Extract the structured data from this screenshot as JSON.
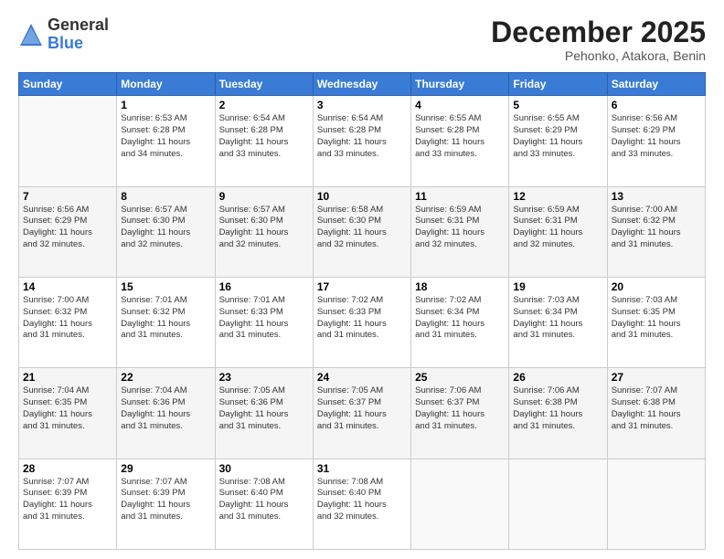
{
  "logo": {
    "general": "General",
    "blue": "Blue"
  },
  "title": "December 2025",
  "location": "Pehonko, Atakora, Benin",
  "days_of_week": [
    "Sunday",
    "Monday",
    "Tuesday",
    "Wednesday",
    "Thursday",
    "Friday",
    "Saturday"
  ],
  "weeks": [
    [
      {
        "day": "",
        "info": ""
      },
      {
        "day": "1",
        "info": "Sunrise: 6:53 AM\nSunset: 6:28 PM\nDaylight: 11 hours\nand 34 minutes."
      },
      {
        "day": "2",
        "info": "Sunrise: 6:54 AM\nSunset: 6:28 PM\nDaylight: 11 hours\nand 33 minutes."
      },
      {
        "day": "3",
        "info": "Sunrise: 6:54 AM\nSunset: 6:28 PM\nDaylight: 11 hours\nand 33 minutes."
      },
      {
        "day": "4",
        "info": "Sunrise: 6:55 AM\nSunset: 6:28 PM\nDaylight: 11 hours\nand 33 minutes."
      },
      {
        "day": "5",
        "info": "Sunrise: 6:55 AM\nSunset: 6:29 PM\nDaylight: 11 hours\nand 33 minutes."
      },
      {
        "day": "6",
        "info": "Sunrise: 6:56 AM\nSunset: 6:29 PM\nDaylight: 11 hours\nand 33 minutes."
      }
    ],
    [
      {
        "day": "7",
        "info": "Sunrise: 6:56 AM\nSunset: 6:29 PM\nDaylight: 11 hours\nand 32 minutes."
      },
      {
        "day": "8",
        "info": "Sunrise: 6:57 AM\nSunset: 6:30 PM\nDaylight: 11 hours\nand 32 minutes."
      },
      {
        "day": "9",
        "info": "Sunrise: 6:57 AM\nSunset: 6:30 PM\nDaylight: 11 hours\nand 32 minutes."
      },
      {
        "day": "10",
        "info": "Sunrise: 6:58 AM\nSunset: 6:30 PM\nDaylight: 11 hours\nand 32 minutes."
      },
      {
        "day": "11",
        "info": "Sunrise: 6:59 AM\nSunset: 6:31 PM\nDaylight: 11 hours\nand 32 minutes."
      },
      {
        "day": "12",
        "info": "Sunrise: 6:59 AM\nSunset: 6:31 PM\nDaylight: 11 hours\nand 32 minutes."
      },
      {
        "day": "13",
        "info": "Sunrise: 7:00 AM\nSunset: 6:32 PM\nDaylight: 11 hours\nand 31 minutes."
      }
    ],
    [
      {
        "day": "14",
        "info": "Sunrise: 7:00 AM\nSunset: 6:32 PM\nDaylight: 11 hours\nand 31 minutes."
      },
      {
        "day": "15",
        "info": "Sunrise: 7:01 AM\nSunset: 6:32 PM\nDaylight: 11 hours\nand 31 minutes."
      },
      {
        "day": "16",
        "info": "Sunrise: 7:01 AM\nSunset: 6:33 PM\nDaylight: 11 hours\nand 31 minutes."
      },
      {
        "day": "17",
        "info": "Sunrise: 7:02 AM\nSunset: 6:33 PM\nDaylight: 11 hours\nand 31 minutes."
      },
      {
        "day": "18",
        "info": "Sunrise: 7:02 AM\nSunset: 6:34 PM\nDaylight: 11 hours\nand 31 minutes."
      },
      {
        "day": "19",
        "info": "Sunrise: 7:03 AM\nSunset: 6:34 PM\nDaylight: 11 hours\nand 31 minutes."
      },
      {
        "day": "20",
        "info": "Sunrise: 7:03 AM\nSunset: 6:35 PM\nDaylight: 11 hours\nand 31 minutes."
      }
    ],
    [
      {
        "day": "21",
        "info": "Sunrise: 7:04 AM\nSunset: 6:35 PM\nDaylight: 11 hours\nand 31 minutes."
      },
      {
        "day": "22",
        "info": "Sunrise: 7:04 AM\nSunset: 6:36 PM\nDaylight: 11 hours\nand 31 minutes."
      },
      {
        "day": "23",
        "info": "Sunrise: 7:05 AM\nSunset: 6:36 PM\nDaylight: 11 hours\nand 31 minutes."
      },
      {
        "day": "24",
        "info": "Sunrise: 7:05 AM\nSunset: 6:37 PM\nDaylight: 11 hours\nand 31 minutes."
      },
      {
        "day": "25",
        "info": "Sunrise: 7:06 AM\nSunset: 6:37 PM\nDaylight: 11 hours\nand 31 minutes."
      },
      {
        "day": "26",
        "info": "Sunrise: 7:06 AM\nSunset: 6:38 PM\nDaylight: 11 hours\nand 31 minutes."
      },
      {
        "day": "27",
        "info": "Sunrise: 7:07 AM\nSunset: 6:38 PM\nDaylight: 11 hours\nand 31 minutes."
      }
    ],
    [
      {
        "day": "28",
        "info": "Sunrise: 7:07 AM\nSunset: 6:39 PM\nDaylight: 11 hours\nand 31 minutes."
      },
      {
        "day": "29",
        "info": "Sunrise: 7:07 AM\nSunset: 6:39 PM\nDaylight: 11 hours\nand 31 minutes."
      },
      {
        "day": "30",
        "info": "Sunrise: 7:08 AM\nSunset: 6:40 PM\nDaylight: 11 hours\nand 31 minutes."
      },
      {
        "day": "31",
        "info": "Sunrise: 7:08 AM\nSunset: 6:40 PM\nDaylight: 11 hours\nand 32 minutes."
      },
      {
        "day": "",
        "info": ""
      },
      {
        "day": "",
        "info": ""
      },
      {
        "day": "",
        "info": ""
      }
    ]
  ]
}
